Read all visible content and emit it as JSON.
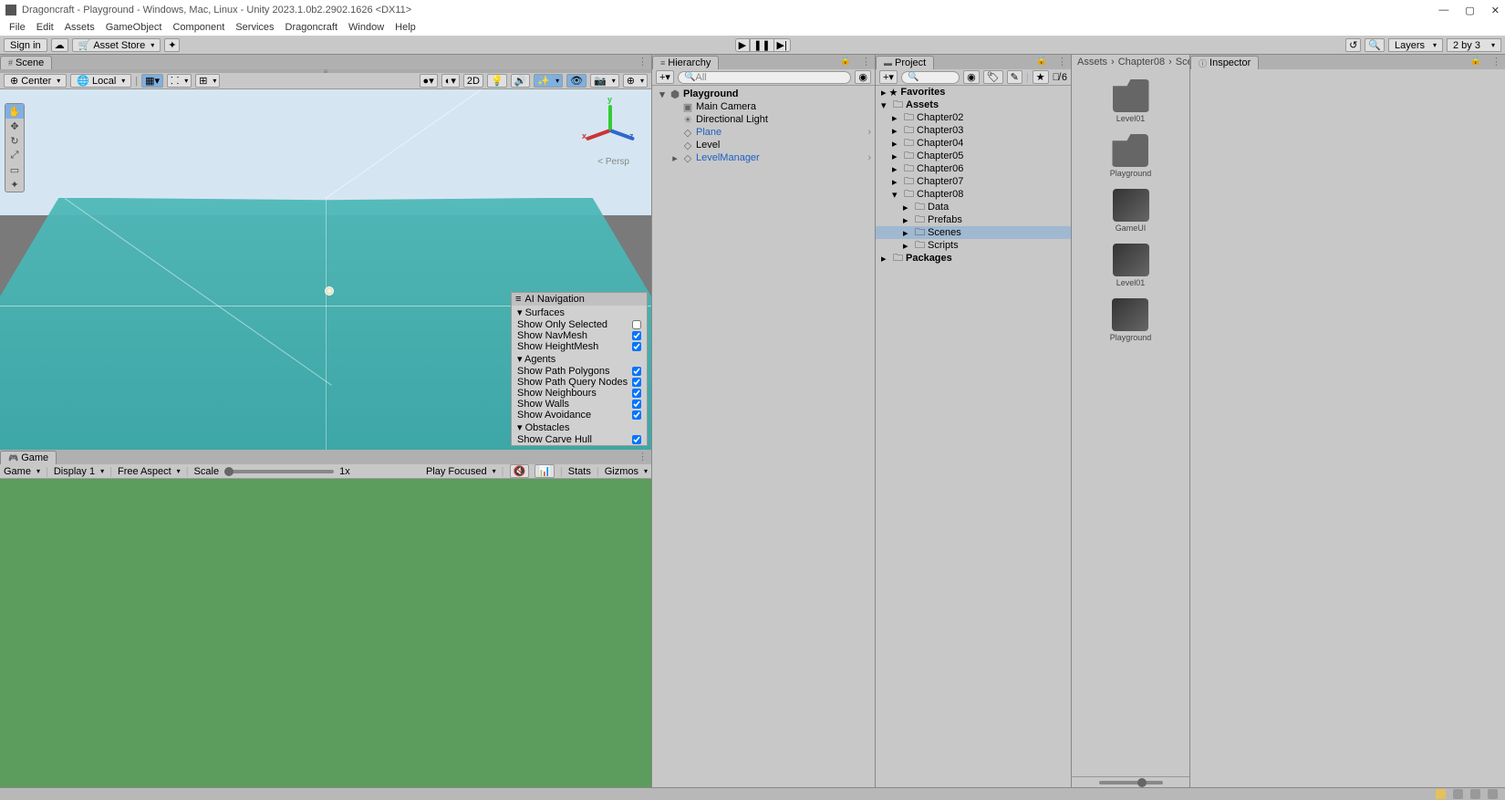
{
  "window": {
    "title": "Dragoncraft - Playground - Windows, Mac, Linux - Unity 2023.1.0b2.2902.1626 <DX11>"
  },
  "menu": {
    "items": [
      "File",
      "Edit",
      "Assets",
      "GameObject",
      "Component",
      "Services",
      "Dragoncraft",
      "Window",
      "Help"
    ]
  },
  "top_toolbar": {
    "signin": "Sign in",
    "asset_store": "Asset Store",
    "layers": "Layers",
    "layout": "2 by 3"
  },
  "tabs": {
    "scene": "Scene",
    "game": "Game",
    "hierarchy": "Hierarchy",
    "project": "Project",
    "inspector": "Inspector"
  },
  "scene_toolbar": {
    "pivot": "Center",
    "space": "Local",
    "two_d": "2D"
  },
  "gizmo": {
    "x": "x",
    "y": "y",
    "z": "z",
    "persp": "< Persp"
  },
  "nav_overlay": {
    "title": "AI Navigation",
    "surfaces": "Surfaces",
    "surface_items": [
      {
        "label": "Show Only Selected",
        "checked": false
      },
      {
        "label": "Show NavMesh",
        "checked": true
      },
      {
        "label": "Show HeightMesh",
        "checked": true
      }
    ],
    "agents": "Agents",
    "agent_items": [
      {
        "label": "Show Path Polygons",
        "checked": true
      },
      {
        "label": "Show Path Query Nodes",
        "checked": true
      },
      {
        "label": "Show Neighbours",
        "checked": true
      },
      {
        "label": "Show Walls",
        "checked": true
      },
      {
        "label": "Show Avoidance",
        "checked": true
      }
    ],
    "obstacles": "Obstacles",
    "obstacle_items": [
      {
        "label": "Show Carve Hull",
        "checked": true
      }
    ]
  },
  "game_toolbar": {
    "game": "Game",
    "display": "Display 1",
    "aspect": "Free Aspect",
    "scale_label": "Scale",
    "scale_val": "1x",
    "play_focused": "Play Focused",
    "stats": "Stats",
    "gizmos": "Gizmos"
  },
  "hierarchy": {
    "search_placeholder": "All",
    "items": [
      {
        "name": "Playground",
        "icon": "unity",
        "depth": 0,
        "expand": "▾",
        "prefab": false,
        "root": true
      },
      {
        "name": "Main Camera",
        "icon": "camera",
        "depth": 1,
        "expand": "",
        "prefab": false
      },
      {
        "name": "Directional Light",
        "icon": "light",
        "depth": 1,
        "expand": "",
        "prefab": false
      },
      {
        "name": "Plane",
        "icon": "cube",
        "depth": 1,
        "expand": "",
        "prefab": true,
        "arrow": true
      },
      {
        "name": "Level",
        "icon": "cube",
        "depth": 1,
        "expand": "",
        "prefab": false
      },
      {
        "name": "LevelManager",
        "icon": "cube",
        "depth": 1,
        "expand": "▸",
        "prefab": true,
        "arrow": true
      }
    ]
  },
  "project": {
    "search_placeholder": "",
    "hidden": "6",
    "favorites": "Favorites",
    "tree": [
      {
        "name": "Assets",
        "depth": 0,
        "expand": "▾",
        "bold": true
      },
      {
        "name": "Chapter02",
        "depth": 1,
        "expand": "▸"
      },
      {
        "name": "Chapter03",
        "depth": 1,
        "expand": "▸"
      },
      {
        "name": "Chapter04",
        "depth": 1,
        "expand": "▸"
      },
      {
        "name": "Chapter05",
        "depth": 1,
        "expand": "▸"
      },
      {
        "name": "Chapter06",
        "depth": 1,
        "expand": "▸"
      },
      {
        "name": "Chapter07",
        "depth": 1,
        "expand": "▸"
      },
      {
        "name": "Chapter08",
        "depth": 1,
        "expand": "▾"
      },
      {
        "name": "Data",
        "depth": 2,
        "expand": "▸"
      },
      {
        "name": "Prefabs",
        "depth": 2,
        "expand": "▸"
      },
      {
        "name": "Scenes",
        "depth": 2,
        "expand": "▸",
        "selected": true
      },
      {
        "name": "Scripts",
        "depth": 2,
        "expand": "▸"
      },
      {
        "name": "Packages",
        "depth": 0,
        "expand": "▸",
        "bold": true
      }
    ]
  },
  "breadcrumb": [
    "Assets",
    "Chapter08",
    "Scen"
  ],
  "assets": [
    {
      "name": "Level01",
      "type": "folder"
    },
    {
      "name": "Playground",
      "type": "folder"
    },
    {
      "name": "GameUI",
      "type": "scene"
    },
    {
      "name": "Level01",
      "type": "scene"
    },
    {
      "name": "Playground",
      "type": "scene"
    }
  ]
}
